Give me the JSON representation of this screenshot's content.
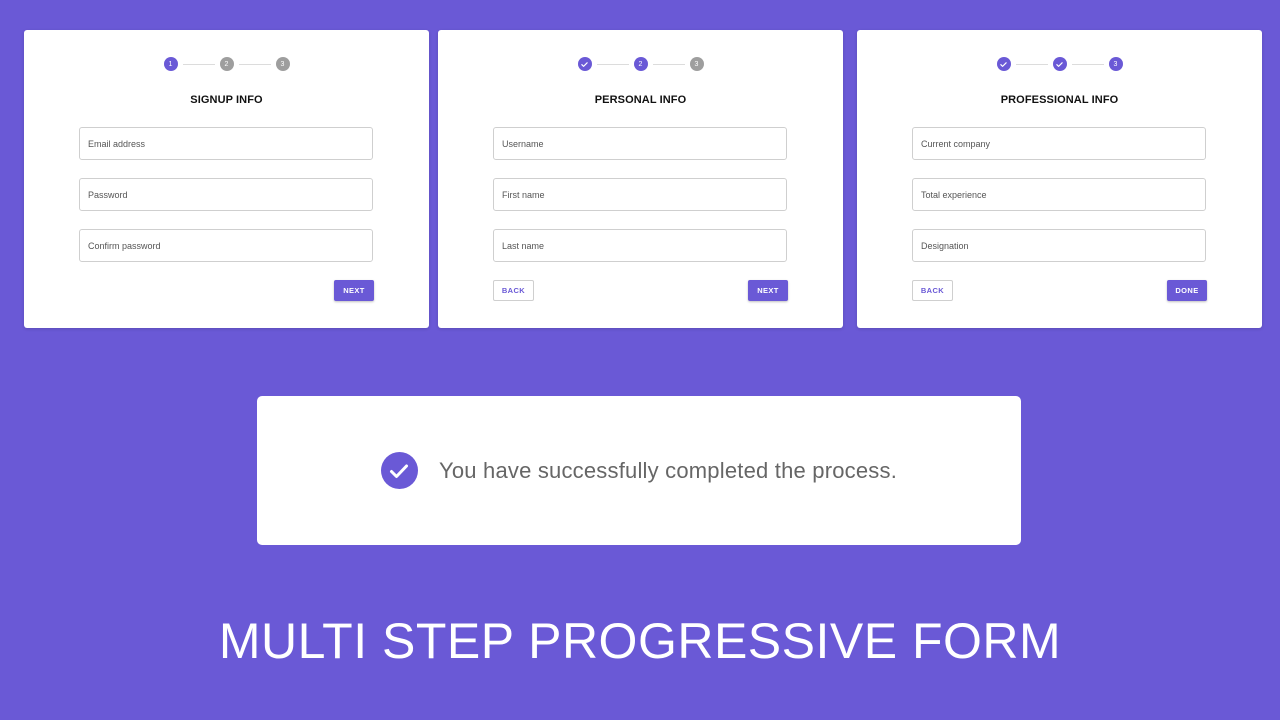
{
  "colors": {
    "background": "#6a59d6",
    "accent": "#6a59d6",
    "inactive_step": "#9e9e9e",
    "card": "#ffffff"
  },
  "cards": [
    {
      "title": "SIGNUP INFO",
      "steps": [
        {
          "label": "1",
          "state": "active"
        },
        {
          "label": "2",
          "state": "pending"
        },
        {
          "label": "3",
          "state": "pending"
        }
      ],
      "fields": [
        {
          "placeholder": "Email address"
        },
        {
          "placeholder": "Password"
        },
        {
          "placeholder": "Confirm password"
        }
      ],
      "next_label": "NEXT"
    },
    {
      "title": "PERSONAL INFO",
      "steps": [
        {
          "label": "",
          "state": "done",
          "icon": "check-icon"
        },
        {
          "label": "2",
          "state": "active"
        },
        {
          "label": "3",
          "state": "pending"
        }
      ],
      "fields": [
        {
          "placeholder": "Username"
        },
        {
          "placeholder": "First name"
        },
        {
          "placeholder": "Last name"
        }
      ],
      "back_label": "BACK",
      "next_label": "NEXT"
    },
    {
      "title": "PROFESSIONAL INFO",
      "steps": [
        {
          "label": "",
          "state": "done",
          "icon": "check-icon"
        },
        {
          "label": "",
          "state": "done",
          "icon": "check-icon"
        },
        {
          "label": "3",
          "state": "active"
        }
      ],
      "fields": [
        {
          "placeholder": "Current company"
        },
        {
          "placeholder": "Total experience"
        },
        {
          "placeholder": "Designation"
        }
      ],
      "back_label": "BACK",
      "done_label": "DONE"
    }
  ],
  "success": {
    "icon": "check-circle-icon",
    "message": "You have successfully completed the process."
  },
  "headline": "MULTI STEP PROGRESSIVE FORM"
}
